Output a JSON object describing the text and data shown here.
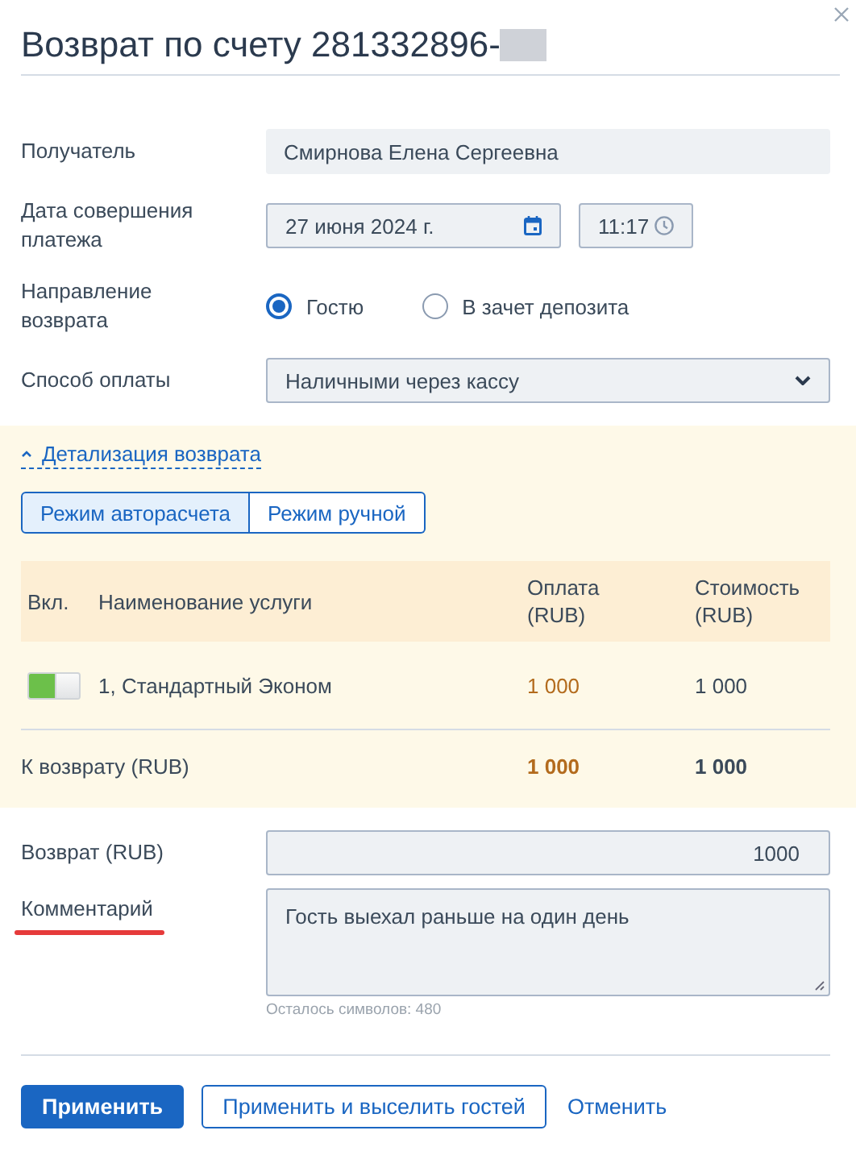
{
  "dialog": {
    "title": "Возврат по счету 281332896-",
    "title_redacted": true
  },
  "fields": [
    {
      "kind": "text",
      "label": "Получатель",
      "value": "Смирнова Елена Сергеевна"
    },
    {
      "kind": "datetime",
      "label": "Дата совершения платежа",
      "date": "27 июня 2024 г.",
      "time": "11:17"
    },
    {
      "kind": "radio",
      "label": "Направление возврата",
      "options": [
        {
          "label": "Гостю",
          "selected": true
        },
        {
          "label": "В зачет депозита",
          "selected": false
        }
      ]
    },
    {
      "kind": "select",
      "label": "Способ оплаты",
      "value": "Наличными через кассу"
    }
  ],
  "details": {
    "toggle": "Детализация возврата",
    "expanded": true,
    "modes": [
      {
        "label": "Режим авторасчета",
        "selected": true
      },
      {
        "label": "Режим ручной",
        "selected": false
      }
    ],
    "table": {
      "columns": [
        "Вкл.",
        "Наименование услуги",
        "Оплата (RUB)",
        "Стоимость (RUB)"
      ],
      "rows": [
        {
          "on": true,
          "name": "1, Стандартный Эконом",
          "payment": "1 000",
          "cost": "1 000"
        }
      ],
      "total": {
        "label": "К возврату (RUB)",
        "payment": "1 000",
        "cost": "1 000"
      }
    }
  },
  "refund": {
    "label": "Возврат (RUB)",
    "value": "1000"
  },
  "comment": {
    "label": "Комментарий",
    "underlined": true,
    "value": "Гость выехал раньше на один день",
    "hint": "Осталось символов: 480"
  },
  "buttons": [
    {
      "kind": "primary",
      "label": "Применить"
    },
    {
      "kind": "outline",
      "label": "Применить и выселить гостей"
    },
    {
      "kind": "link",
      "label": "Отменить"
    }
  ]
}
